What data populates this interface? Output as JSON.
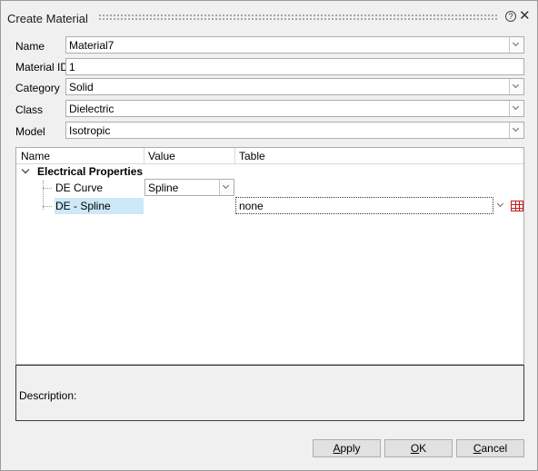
{
  "dialog": {
    "title": "Create Material",
    "help_glyph": "?",
    "close_glyph": "✕"
  },
  "form": {
    "name": {
      "label": "Name",
      "value": "Material7"
    },
    "material_id": {
      "label": "Material ID",
      "value": "1"
    },
    "category": {
      "label": "Category",
      "value": "Solid"
    },
    "class": {
      "label": "Class",
      "value": "Dielectric"
    },
    "model": {
      "label": "Model",
      "value": "Isotropic"
    }
  },
  "tree": {
    "columns": [
      "Name",
      "Value",
      "Table"
    ],
    "group": {
      "label": "Electrical Properties",
      "expanded": true
    },
    "rows": [
      {
        "name": "DE Curve",
        "value": "Spline",
        "table": ""
      },
      {
        "name": "DE - Spline",
        "value": "",
        "table": "none",
        "selected": true
      }
    ]
  },
  "description": {
    "label": "Description:"
  },
  "buttons": {
    "apply": {
      "mnemonic": "A",
      "rest": "pply"
    },
    "ok": {
      "mnemonic": "O",
      "rest": "K"
    },
    "cancel": {
      "mnemonic": "C",
      "rest": "ancel"
    }
  },
  "icons": {
    "table_icon_color": "#c41a1a",
    "selection_color": "#cde8f6"
  }
}
